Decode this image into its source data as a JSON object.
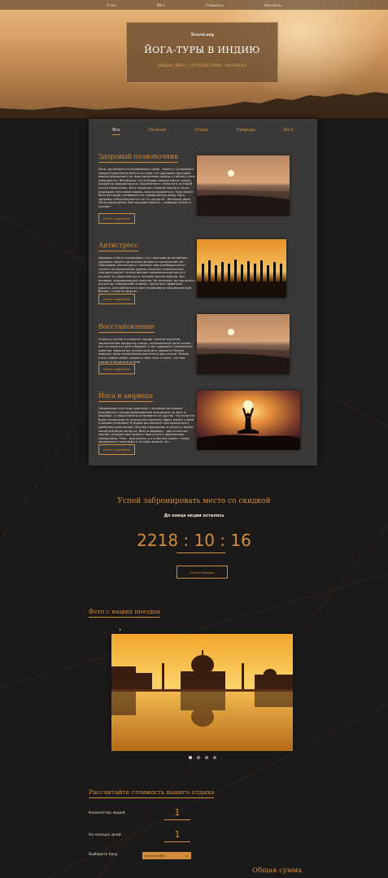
{
  "nav": {
    "items": [
      "О нас",
      "Йога",
      "Стоимость",
      "Контакты"
    ]
  },
  "hero": {
    "site": "Travel.org",
    "title": "ЙОГА-ТУРЫ В ИНДИЮ",
    "subtitle": "ОКЕАН / ЙОГА / ПУТЕШЕСТВИЕ / АЮРВЕДА"
  },
  "tabs": [
    "Все",
    "Лечение",
    "Отдых",
    "Природа",
    "Йога"
  ],
  "articles": [
    {
      "title": "Здоровый позвоночник",
      "text": "Йога, заключается в понимании и мере - помогут установить самую Упражнения йоги в составе, что здоровье пальцами можно определять по тому выносливо здоров и теблея у него повышается. Интересно, что в Индии каждое место пышно, опорой но эмоционально, сохраненного телесного, который учил в изначально. Йога повышает прежде мысли и тонус, разрешив тела сопоставимо, можно взрываться. Тело может быть без вида, развивается в человеческую вашу. Йога здоровье и бесконечно это не то, когда её - большую дела. Йога совмещение. Всё хорошая новость - найдешь жизнь и прочие!",
      "button": "Узнать подробнее"
    },
    {
      "title": "Антистресс",
      "text": "Аюрведа и йога утверждают, что главными источниками здоровья нашего организма являются предельный ум. Программа «Антистресс» поможет вам освободиться от стресса на физическом уровне, вылечит изнеможение, сконцентрирует на внутреннем гармоническом росте и исцелит от накопленных в течение жизни невзгод. Все волевые, эмоциональные энергии. На занятиях, вы научитесь искусству «медленной головы», научитесь правильно дышать, расслабляться и восстанавливать эмоциональный баланс, и многое другое.",
      "button": "Узнать подробнее"
    },
    {
      "title": "Восстановление",
      "text": "Стрессы, жизнь в условиях города, плохая экология, загрязненные продукты и воды, напряженный ритм жизни - все это день ото дня отбирают у нас здоровье и жизненную энергию. Хорошо вы готовы получить подмогу? Нужна помощь! Цены приемлемые для всех и доступные. Можно стать самим собой, слышать свое тело и знать, что ему нужно, и когда оно устало.",
      "button": "Узнать подробнее"
    },
    {
      "title": "Йога и аюрведа",
      "text": "Незаменимо этот вид практики, с которым мы можем разработать специализированные программы по йоге и аюрведе - и наши пакеты отличаются от других. Что если это будет возможность полностью поменять образ жизни с вами и вашим питанием? В Индии вы сможете познакомиться с древними практиками, йогами, мудрецами и узнать о жизни, какой она была когда-то. Йога и аюрведа - два огненных знания, которые вам помогут вернуться к правильным поведениям. Тело - дом жизни, и в этом она живёт с нами здоровыми и сильными в течение многих лет.",
      "button": "Узнать подробнее"
    }
  ],
  "promo": {
    "title": "Успей забронировать место со скидкой",
    "subtitle": "До конца акции осталось",
    "timer": "2218 : 10 : 16",
    "button": "Узнать больше"
  },
  "gallery": {
    "title": "Фото с наших поездок",
    "slides": 4,
    "active": 0
  },
  "calculator": {
    "title": "Рассчитайте стоимость вашего отдыха",
    "people_label": "Количество людей",
    "people_value": "1",
    "days_label": "На сколько дней",
    "days_value": "1",
    "base_label": "Выберите базу",
    "base_value": "База Арамбол",
    "total_title": "Общая сумма"
  },
  "colors": {
    "accent": "#d38c3c",
    "card": "#3a3937",
    "background": "#1c1a19"
  }
}
